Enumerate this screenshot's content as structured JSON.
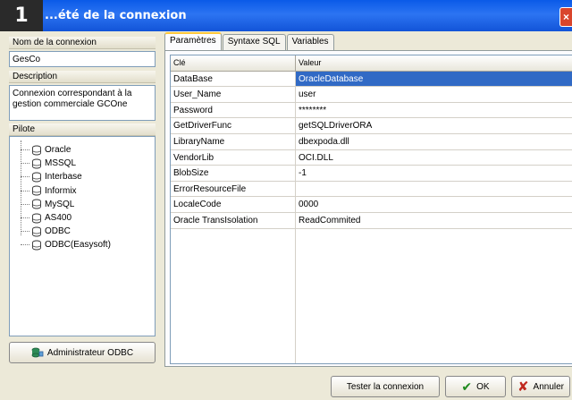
{
  "titlebar": {
    "step": "1",
    "title": "...été de la connexion",
    "close": "×"
  },
  "left": {
    "name_label": "Nom de la connexion",
    "name_value": "GesCo",
    "desc_label": "Description",
    "desc_value": "Connexion correspondant à la gestion commerciale GCOne",
    "driver_label": "Pilote",
    "drivers": [
      "Oracle",
      "MSSQL",
      "Interbase",
      "Informix",
      "MySQL",
      "AS400",
      "ODBC",
      "ODBC(Easysoft)"
    ],
    "odbc_button": "Administrateur ODBC"
  },
  "tabs": [
    "Paramètres",
    "Syntaxe SQL",
    "Variables"
  ],
  "grid": {
    "headers": [
      "Clé",
      "Valeur"
    ],
    "rows": [
      {
        "key": "DataBase",
        "value": "OracleDatabase"
      },
      {
        "key": "User_Name",
        "value": "user"
      },
      {
        "key": "Password",
        "value": "********"
      },
      {
        "key": "GetDriverFunc",
        "value": "getSQLDriverORA"
      },
      {
        "key": "LibraryName",
        "value": "dbexpoda.dll"
      },
      {
        "key": "VendorLib",
        "value": "OCI.DLL"
      },
      {
        "key": "BlobSize",
        "value": "-1"
      },
      {
        "key": "ErrorResourceFile",
        "value": ""
      },
      {
        "key": "LocaleCode",
        "value": "0000"
      },
      {
        "key": "Oracle TransIsolation",
        "value": "ReadCommited"
      }
    ]
  },
  "footer": {
    "test_button": "Tester la connexion",
    "ok_button": "OK",
    "cancel_button": "Annuler"
  },
  "colors": {
    "selection": "#316AC5",
    "titlebar": "#2C74F2"
  }
}
